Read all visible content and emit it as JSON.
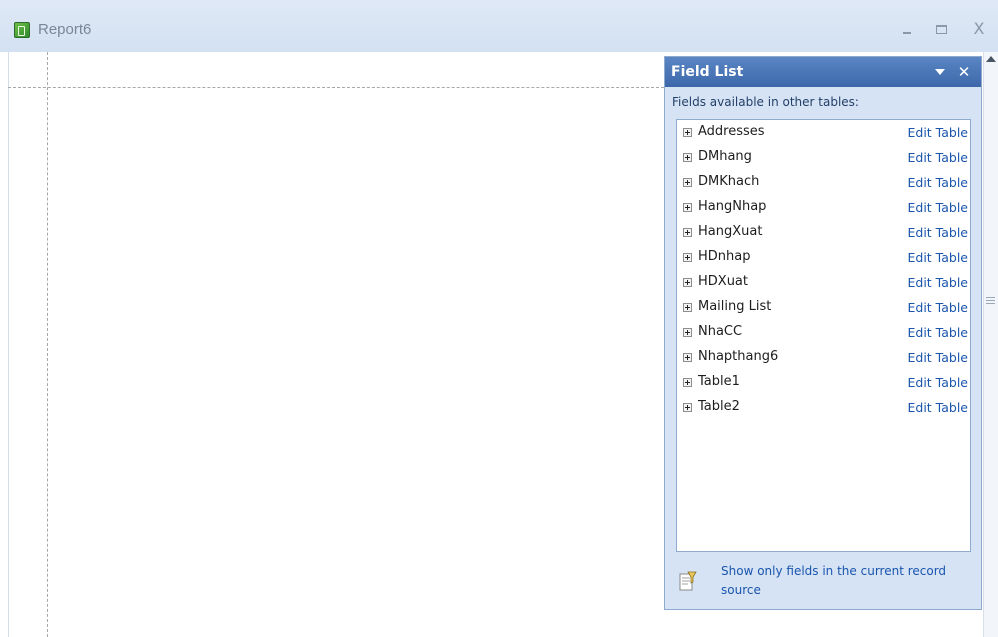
{
  "window": {
    "title": "Report6",
    "minimize_glyph": "",
    "maximize_glyph": "",
    "close_glyph": "X"
  },
  "field_list": {
    "title": "Field List",
    "close_glyph": "✕",
    "subtitle": "Fields available in other tables:",
    "tables": [
      {
        "name": "Addresses",
        "action": "Edit Table"
      },
      {
        "name": "DMhang",
        "action": "Edit Table"
      },
      {
        "name": "DMKhach",
        "action": "Edit Table"
      },
      {
        "name": "HangNhap",
        "action": "Edit Table"
      },
      {
        "name": "HangXuat",
        "action": "Edit Table"
      },
      {
        "name": "HDnhap",
        "action": "Edit Table"
      },
      {
        "name": "HDXuat",
        "action": "Edit Table"
      },
      {
        "name": "Mailing List",
        "action": "Edit Table"
      },
      {
        "name": "NhaCC",
        "action": "Edit Table"
      },
      {
        "name": "Nhapthang6",
        "action": "Edit Table"
      },
      {
        "name": "Table1",
        "action": "Edit Table"
      },
      {
        "name": "Table2",
        "action": "Edit Table"
      }
    ],
    "footer_link": "Show only fields in the current record source"
  },
  "icons": {
    "app": "report-icon",
    "expand": "plus-box-icon",
    "footer": "filter-list-icon"
  },
  "colors": {
    "title_bar": "#d3e1f2",
    "pane_header": "#3d67aa",
    "link": "#1a55ae"
  }
}
